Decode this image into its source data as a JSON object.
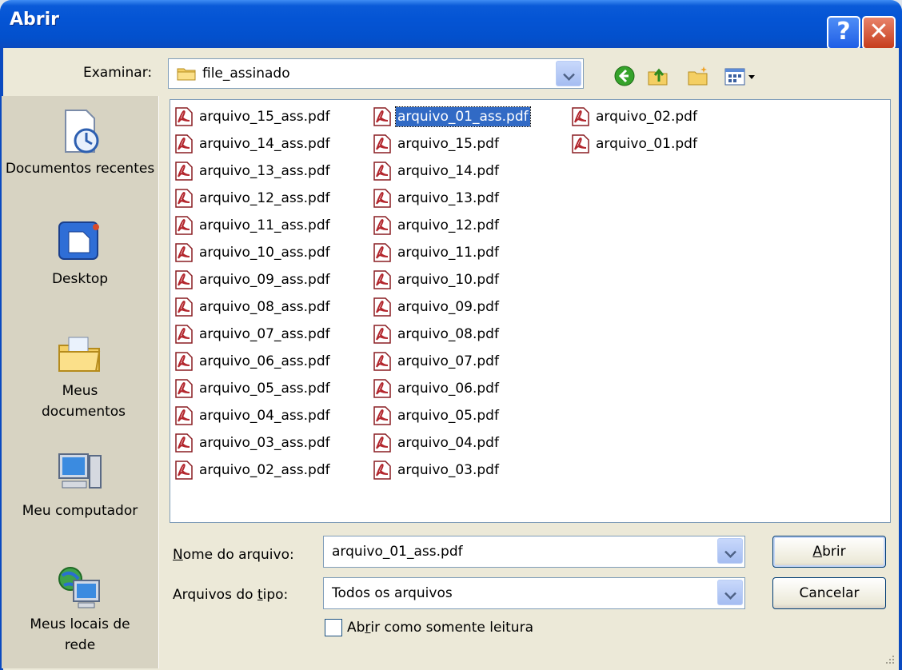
{
  "window": {
    "title": "Abrir"
  },
  "titlebar_buttons": {
    "help": "?",
    "close": "✕"
  },
  "lookin": {
    "label": "Examinar:",
    "label_hotkey": "x",
    "value": "file_assinado"
  },
  "toolbar": {
    "icons": [
      "back-icon",
      "up-folder-icon",
      "new-folder-icon",
      "view-menu-icon"
    ]
  },
  "places": [
    {
      "label": "Documentos recentes",
      "icon": "recent-documents-icon"
    },
    {
      "label": "Desktop",
      "icon": "desktop-icon"
    },
    {
      "label": "Meus documentos",
      "icon": "my-documents-icon"
    },
    {
      "label": "Meu computador",
      "icon": "my-computer-icon"
    },
    {
      "label": "Meus locais de rede",
      "icon": "network-places-icon"
    }
  ],
  "files": {
    "col1": [
      "arquivo_15_ass.pdf",
      "arquivo_14_ass.pdf",
      "arquivo_13_ass.pdf",
      "arquivo_12_ass.pdf",
      "arquivo_11_ass.pdf",
      "arquivo_10_ass.pdf",
      "arquivo_09_ass.pdf",
      "arquivo_08_ass.pdf",
      "arquivo_07_ass.pdf",
      "arquivo_06_ass.pdf",
      "arquivo_05_ass.pdf",
      "arquivo_04_ass.pdf",
      "arquivo_03_ass.pdf",
      "arquivo_02_ass.pdf"
    ],
    "col2": [
      "arquivo_01_ass.pdf",
      "arquivo_15.pdf",
      "arquivo_14.pdf",
      "arquivo_13.pdf",
      "arquivo_12.pdf",
      "arquivo_11.pdf",
      "arquivo_10.pdf",
      "arquivo_09.pdf",
      "arquivo_08.pdf",
      "arquivo_07.pdf",
      "arquivo_06.pdf",
      "arquivo_05.pdf",
      "arquivo_04.pdf",
      "arquivo_03.pdf"
    ],
    "col3": [
      "arquivo_02.pdf",
      "arquivo_01.pdf"
    ],
    "selected": "arquivo_01_ass.pdf"
  },
  "filename": {
    "label": "Nome do arquivo:",
    "value": "arquivo_01_ass.pdf"
  },
  "filetype": {
    "label": "Arquivos do tipo:",
    "value": "Todos os arquivos"
  },
  "readonly": {
    "label": "Abrir como somente leitura",
    "checked": false
  },
  "buttons": {
    "open": "Abrir",
    "cancel": "Cancelar"
  },
  "colors": {
    "title_blue": "#0454d4",
    "selection": "#316ac5",
    "pdf_red": "#b3262d"
  }
}
